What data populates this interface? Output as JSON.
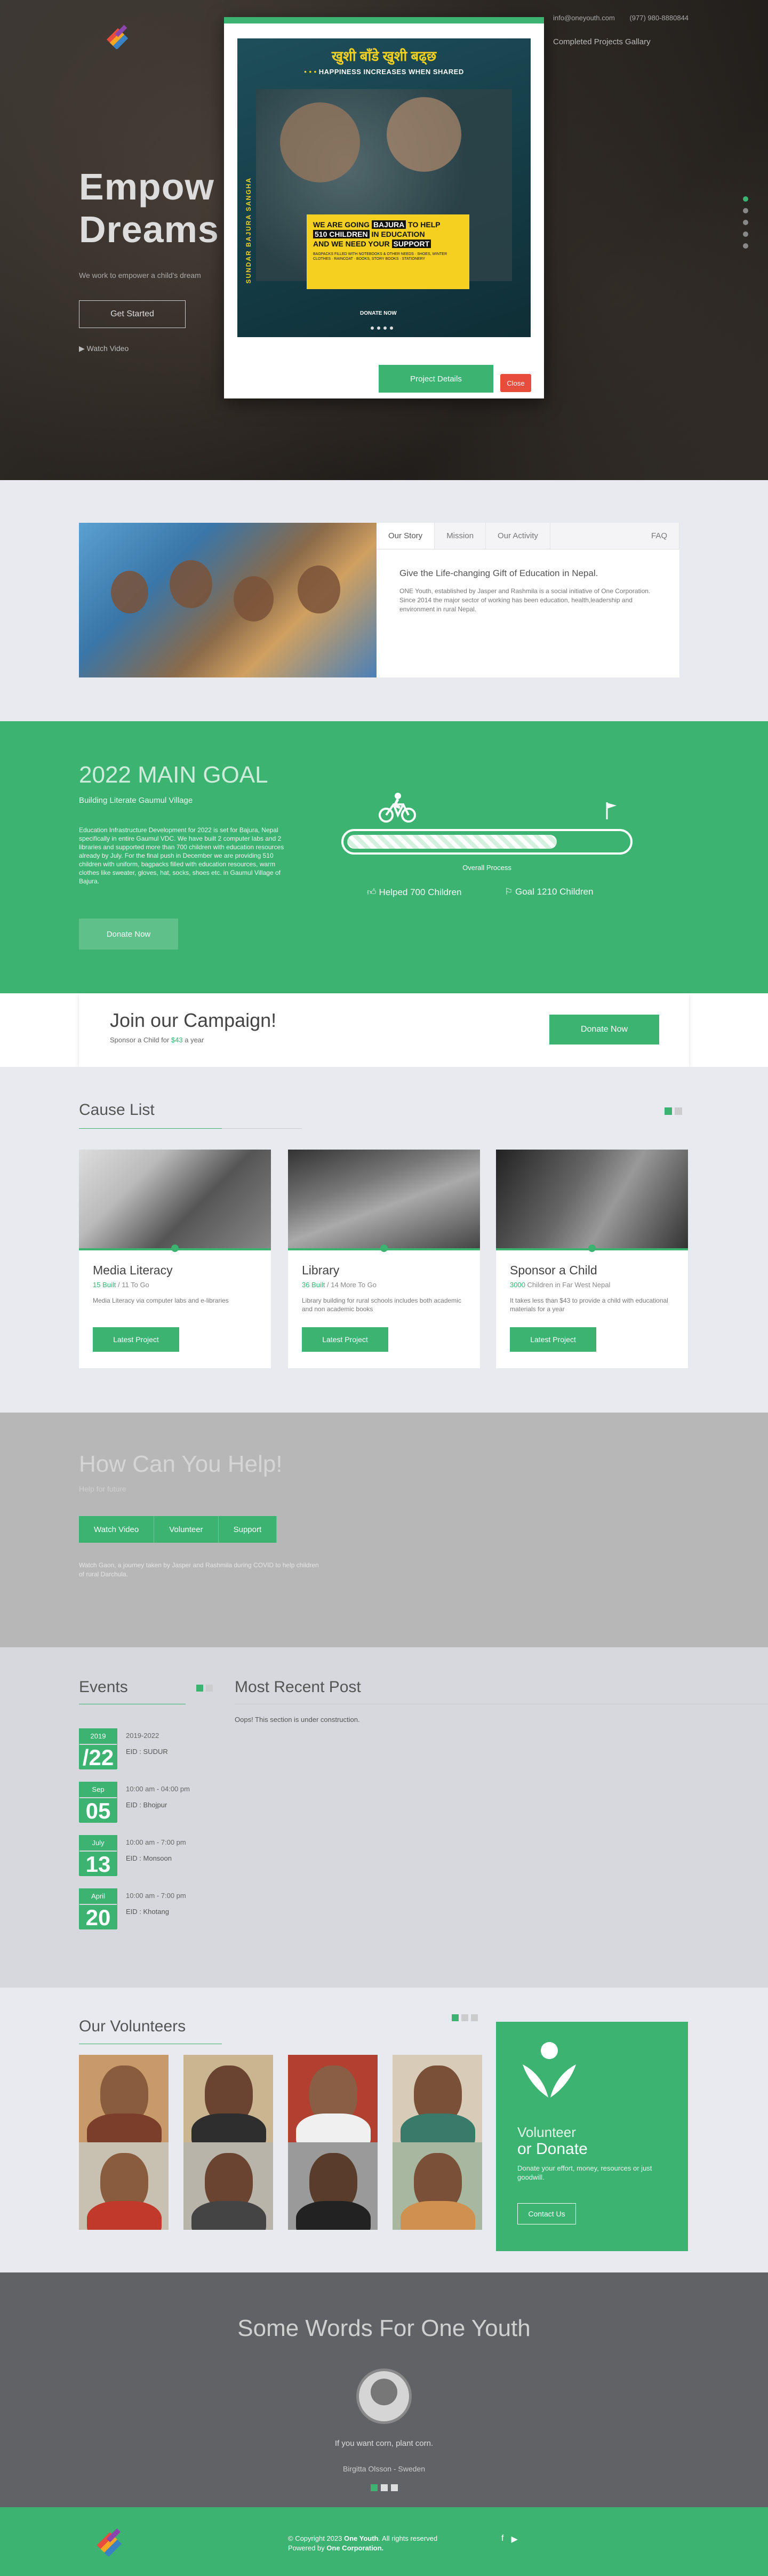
{
  "header": {
    "email": "info@oneyouth.com",
    "phone": "(977) 980-8880844",
    "gallery_link": "Completed Projects Gallary"
  },
  "hero": {
    "title_line1": "Empow",
    "title_line2": "Dreams",
    "subtitle": "We work to empower a child's dream",
    "get_started": "Get Started",
    "watch_video": "Watch Video"
  },
  "modal": {
    "poster_nepali": "खुशी बाँडे खुशी बढ्छ",
    "poster_happiness": "HAPPINESS INCREASES WHEN SHARED",
    "poster_line1": "WE ARE GOING",
    "poster_highlight1": "BAJURA",
    "poster_line1b": "TO HELP",
    "poster_highlight2": "510 CHILDREN",
    "poster_line2b": "IN EDUCATION",
    "poster_line3": "AND WE NEED YOUR",
    "poster_highlight3": "SUPPORT",
    "poster_small": "BAGPACKS FILLED WITH NOTEBOOKS & OTHER NEEDS · SHOES, WINTER CLOTHES · RAINCOAT · BOOKS, STORY BOOKS · STATIONERY",
    "poster_side": "SUNDAR BAJURA SANGHA",
    "poster_donate": "DONATE NOW",
    "project_details": "Project Details",
    "close": "Close"
  },
  "about": {
    "tabs": [
      "Our Story",
      "Mission",
      "Our Activity",
      "FAQ"
    ],
    "heading": "Give the Life-changing Gift of Education in Nepal.",
    "text": "ONE Youth, established by Jasper and Rashmila is a social initiative of One Corporation. Since 2014 the major sector of working has been education, health,leadership and environment in rural Nepal."
  },
  "goal": {
    "title": "2022 MAIN GOAL",
    "subtitle": "Building Literate Gaumul Village",
    "description": "Education Infrastructure Development for 2022 is set for Bajura, Nepal specifically in entire Gaumul VDC. We have built 2 computer labs and 2 libraries and supported more than 700 children with education resources already by July. For the final push in December we are providing 510 children with uniform, bagpacks filled with education resources, warm clothes like sweater, gloves, hat, socks, shoes etc. in Gaumul Village of Bajura.",
    "donate": "Donate Now",
    "progress_label": "Overall Process",
    "progress": 0.75,
    "helped": "Helped 700 Children",
    "goal_text": "Goal 1210 Children"
  },
  "campaign": {
    "title": "Join our Campaign!",
    "subtitle_pre": "Sponsor a Child for",
    "subtitle_amount": "$43",
    "subtitle_post": "a year",
    "button": "Donate Now"
  },
  "causes": {
    "title": "Cause List",
    "latest": "Latest Project",
    "items": [
      {
        "title": "Media Literacy",
        "built": "15 Built",
        "togo": "/ 11 To Go",
        "desc": "Media Literacy via computer labs and e-libraries"
      },
      {
        "title": "Library",
        "built": "36 Built",
        "togo": "/ 14 More To Go",
        "desc": "Library building for rural schools includes both academic and non academic books"
      },
      {
        "title": "Sponsor a Child",
        "built": "3000",
        "togo": "Children in Far West Nepal",
        "desc": "It takes less than $43 to provide a child with educational materials for a year"
      }
    ]
  },
  "help": {
    "title": "How Can You Help!",
    "subtitle": "Help for future",
    "buttons": [
      "Watch Video",
      "Volunteer",
      "Support"
    ],
    "text": "Watch Gaon, a journey taken by Jasper and Rashmila during COVID to help children of rural Darchula."
  },
  "events": {
    "title": "Events",
    "items": [
      {
        "month": "2019",
        "day": "/22",
        "time": "2019-2022",
        "name": "EID : SUDUR"
      },
      {
        "month": "Sep",
        "day": "05",
        "time": "10:00 am - 04:00 pm",
        "name": "EID : Bhojpur"
      },
      {
        "month": "July",
        "day": "13",
        "time": "10:00 am - 7:00 pm",
        "name": "EID : Monsoon"
      },
      {
        "month": "April",
        "day": "20",
        "time": "10:00 am - 7:00 pm",
        "name": "EID : Khotang"
      }
    ],
    "recent_title": "Most Recent Post",
    "recent_text": "Oops! This section is under construction."
  },
  "volunteers": {
    "title": "Our Volunteers",
    "donate_line1": "Volunteer",
    "donate_line2": "or Donate",
    "donate_text": "Donate your effort, money, resources or just goodwill.",
    "contact": "Contact Us"
  },
  "testimonial": {
    "title": "Some Words For One Youth",
    "quote": "If you want corn, plant corn.",
    "author": "Birgitta Olsson - Sweden"
  },
  "footer": {
    "copy_pre": "© Copyright 2023",
    "copy_brand": "One Youth",
    "copy_post": ". All rights reserved",
    "powered_pre": "Powered by",
    "powered_brand": "One Corporation."
  },
  "colors": {
    "accent": "#3cb371",
    "close": "#e74c3c"
  }
}
